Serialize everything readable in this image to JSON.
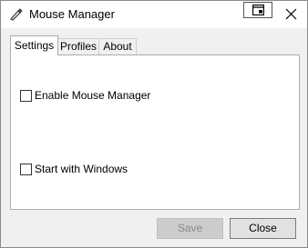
{
  "window": {
    "title": "Mouse Manager",
    "app_icon": "mouse-pen-icon",
    "controls": {
      "snap_icon": "snap-layout-icon",
      "close_icon": "close-icon"
    }
  },
  "tabs": [
    {
      "label": "Settings",
      "active": true
    },
    {
      "label": "Profiles",
      "active": false
    },
    {
      "label": "About",
      "active": false
    }
  ],
  "settings": {
    "enable_label": "Enable Mouse Manager",
    "enable_checked": false,
    "start_label": "Start with Windows",
    "start_checked": false
  },
  "buttons": {
    "save_label": "Save",
    "save_enabled": false,
    "close_label": "Close"
  }
}
